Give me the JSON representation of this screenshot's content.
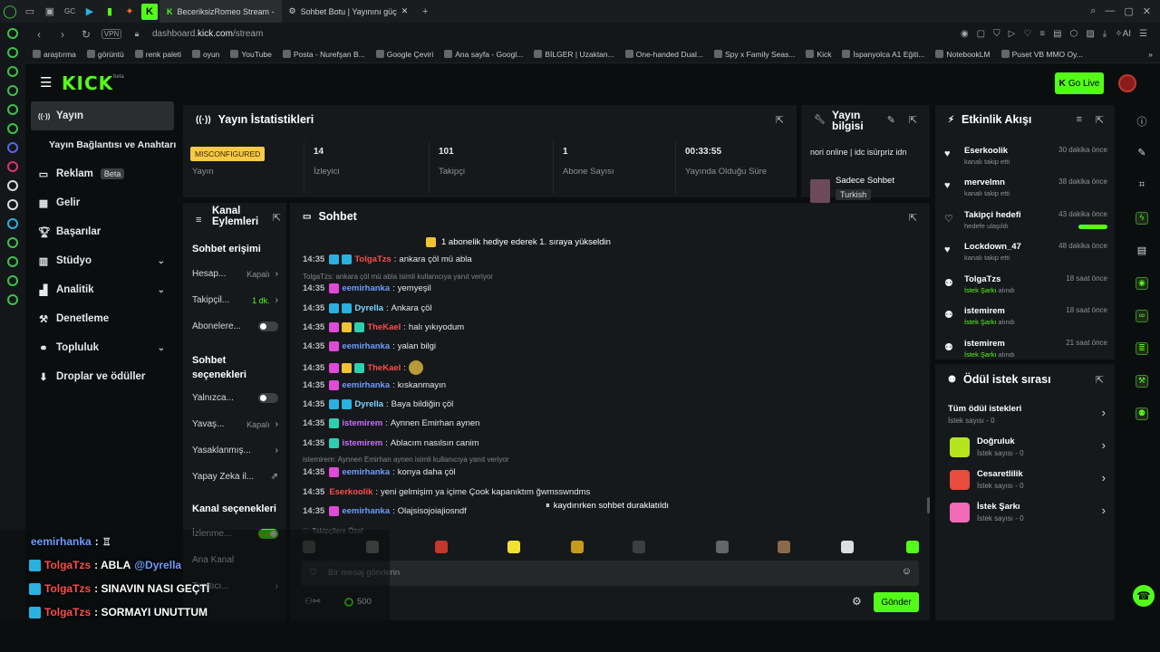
{
  "browser": {
    "tabs": [
      {
        "label": "BeceriksizRomeo Stream -"
      },
      {
        "label": "Sohbet Botu | Yayınını güç"
      }
    ],
    "url_prefix": "dashboard.",
    "url_host": "kick.com",
    "url_path": "/stream",
    "bookmarks": [
      "araştırma",
      "görüntü",
      "renk paleti",
      "oyun",
      "YouTube",
      "Posta - Nurefşan B...",
      "Google Çeviri",
      "Ana sayfa - Googl...",
      "BİLGER | Uzaktan...",
      "One-handed Dual...",
      "Spy x Family Seas...",
      "Kick",
      "İspanyolca A1 Eğiti...",
      "NotebookLM",
      "Puset VB MMO Oy..."
    ]
  },
  "header": {
    "logo": "KICK",
    "go_live": "Go Live"
  },
  "sidebar": {
    "items": [
      {
        "label": "Yayın",
        "icon": "stream-icon"
      },
      {
        "label": "Yayın Bağlantısı ve Anahtarı",
        "icon": ""
      },
      {
        "label": "Reklam",
        "icon": "ad-icon",
        "badge": "Beta"
      },
      {
        "label": "Gelir",
        "icon": "revenue-icon"
      },
      {
        "label": "Başarılar",
        "icon": "trophy-icon"
      },
      {
        "label": "Stüdyo",
        "icon": "studio-icon"
      },
      {
        "label": "Analitik",
        "icon": "analytics-icon"
      },
      {
        "label": "Denetleme",
        "icon": "moderation-icon"
      },
      {
        "label": "Topluluk",
        "icon": "community-icon"
      },
      {
        "label": "Droplar ve ödüller",
        "icon": "drops-icon"
      }
    ]
  },
  "stats": {
    "title": "Yayın İstatistikleri",
    "status_badge": "MISCONFIGURED",
    "status_label": "Yayın",
    "cells": [
      {
        "value": "14",
        "label": "İzleyici"
      },
      {
        "value": "101",
        "label": "Takipçi"
      },
      {
        "value": "1",
        "label": "Abone Sayısı"
      },
      {
        "value": "00:33:55",
        "label": "Yayında Olduğu Süre"
      }
    ]
  },
  "stream_info": {
    "title": "Yayın bilgisi",
    "stream_title": "nori online | idc isürpriz idn",
    "category": "Sadece Sohbet",
    "language": "Turkish"
  },
  "channel_actions": {
    "title_line1": "Kanal",
    "title_line2": "Eylemleri",
    "chat_access": "Sohbet erişimi",
    "rows1": [
      {
        "label": "Hesap...",
        "value": "Kapalı",
        "kind": "arrow"
      },
      {
        "label": "Takipçil...",
        "value": "1 dk.",
        "kind": "arrow"
      },
      {
        "label": "Abonelere...",
        "value": "",
        "kind": "toggle-off"
      }
    ],
    "chat_options_line1": "Sohbet",
    "chat_options_line2": "seçenekleri",
    "rows2": [
      {
        "label": "Yalnızca...",
        "value": "",
        "kind": "toggle-off"
      },
      {
        "label": "Yavaş...",
        "value": "Kapalı",
        "kind": "arrow"
      },
      {
        "label": "Yasaklanmış...",
        "value": "",
        "kind": "arrow"
      },
      {
        "label": "Yapay Zeka il...",
        "value": "",
        "kind": "ext"
      }
    ],
    "channel_options": "Kanal seçenekleri",
    "rows3": [
      {
        "label": "İzlenme...",
        "value": "",
        "kind": "toggle-on"
      },
      {
        "label": "Ana Kanal",
        "value": "",
        "kind": "none"
      },
      {
        "label": "Tanıtıcı...",
        "value": "",
        "kind": "arrow"
      }
    ]
  },
  "chat": {
    "title": "Sohbet",
    "pinned": "1 abonelik hediye ederek 1. sıraya yükseldin",
    "messages": [
      {
        "time": "14:35",
        "user": "TolgaTzs",
        "color": "#ff4c4c",
        "text": "ankara çöl mü abla",
        "badges": [
          "#2bb0e0",
          "#2bb0e0"
        ]
      },
      {
        "reply": "TolgaTzs: ankara çöl mü abla isimli kullanıcıya yanıt veriyor"
      },
      {
        "time": "14:35",
        "user": "eemirhanka",
        "color": "#6d9cff",
        "text": "yemyeşil",
        "badges": [
          "#e04ad8"
        ]
      },
      {
        "time": "14:35",
        "user": "Dyrella",
        "color": "#7fd6ff",
        "text": "Ankara çöl",
        "badges": [
          "#2bb0e0",
          "#2bb0e0"
        ]
      },
      {
        "time": "14:35",
        "user": "TheKael",
        "color": "#ff4c4c",
        "text": "halı yıkıyodum",
        "badges": [
          "#e04ad8",
          "#f1c232",
          "#2bd0b0"
        ]
      },
      {
        "time": "14:35",
        "user": "eemirhanka",
        "color": "#6d9cff",
        "text": "yalan bilgi",
        "badges": [
          "#e04ad8"
        ]
      },
      {
        "time": "14:35",
        "user": "TheKael",
        "color": "#ff4c4c",
        "text": "",
        "badges": [
          "#e04ad8",
          "#f1c232",
          "#2bd0b0"
        ],
        "emote": true
      },
      {
        "time": "14:35",
        "user": "eemirhanka",
        "color": "#6d9cff",
        "text": "kıskanmayın",
        "badges": [
          "#e04ad8"
        ]
      },
      {
        "time": "14:35",
        "user": "Dyrella",
        "color": "#7fd6ff",
        "text": "Baya bildiğin çöl",
        "badges": [
          "#2bb0e0",
          "#2bb0e0"
        ]
      },
      {
        "time": "14:35",
        "user": "istemirem",
        "color": "#c86dff",
        "text": "Aynnen Emirhan aynen",
        "badges": [
          "#2bd0b0"
        ]
      },
      {
        "time": "14:35",
        "user": "istemirem",
        "color": "#c86dff",
        "text": "Ablacım nasılsın canim",
        "badges": [
          "#2bd0b0"
        ]
      },
      {
        "reply": "istemirem: Aynnen Emirhan aynen isimli kullanıcıya yanıt veriyor"
      },
      {
        "time": "14:35",
        "user": "eemirhanka",
        "color": "#6d9cff",
        "text": "konya daha çöl",
        "badges": [
          "#e04ad8"
        ]
      },
      {
        "time": "14:35",
        "user": "Eserkoolik",
        "color": "#ff4c4c",
        "text": "yeni gelmişim ya içime Çook kapanıktım ğwmsswndms",
        "badges": []
      },
      {
        "time": "14:35",
        "user": "eemirhanka",
        "color": "#6d9cff",
        "text": "Olajsisojoiajiosndf",
        "badges": [
          "#e04ad8"
        ]
      }
    ],
    "paused": "kaydırırken sohbet duraklatıldı",
    "followers_only": "Takipçilere Özel",
    "input_placeholder": "Bir mesaj gönderin",
    "points": "500",
    "send": "Gönder"
  },
  "events": {
    "title": "Etkinlik Akışı",
    "items": [
      {
        "name": "Eserkoolik",
        "sub": "kanalı takip etti",
        "time": "30 dakika önce",
        "icon": "heart-icon"
      },
      {
        "name": "mervelmn",
        "sub": "kanalı takip etti",
        "time": "38 dakika önce",
        "icon": "heart-icon"
      },
      {
        "name": "Takipçi hedefi",
        "sub": "hedefe ulaşıldı",
        "time": "43 dakika önce",
        "icon": "heart-outline-icon",
        "progress": 1.0
      },
      {
        "name": "Lockdown_47",
        "sub": "kanalı takip etti",
        "time": "48 dakika önce",
        "icon": "heart-icon"
      },
      {
        "name": "TolgaTzs",
        "sub_green": "İstek Şarkı",
        "sub": " alındı",
        "time": "18 saat önce",
        "icon": "reward-icon"
      },
      {
        "name": "istemirem",
        "sub_green": "İstek Şarkı",
        "sub": " alındı",
        "time": "18 saat önce",
        "icon": "reward-icon"
      },
      {
        "name": "istemirem",
        "sub_green": "İstek Şarkı",
        "sub": " alındı",
        "time": "21 saat önce",
        "icon": "reward-icon"
      }
    ]
  },
  "rewards": {
    "title": "Ödül istek sırası",
    "all": {
      "name": "Tüm ödül istekleri",
      "sub": "İstek sayısı - 0"
    },
    "items": [
      {
        "name": "Doğruluk",
        "sub": "İstek sayısı - 0",
        "color": "#b5e61d"
      },
      {
        "name": "Cesaretlilik",
        "sub": "İstek sayısı - 0",
        "color": "#e74c3c"
      },
      {
        "name": "İstek Şarkı",
        "sub": "İstek sayısı - 0",
        "color": "#f06ab7"
      }
    ]
  },
  "overlay": {
    "lines": [
      {
        "user": "eemirhanka",
        "text": ":",
        "kind": "m"
      },
      {
        "user": "TolgaTzs",
        "text": ": ABLA ",
        "mention": "@Dyrella",
        "kind": "n"
      },
      {
        "user": "TolgaTzs",
        "text": ": SINAVIN NASI GEÇTİ",
        "kind": "n"
      },
      {
        "user": "TolgaTzs",
        "text": ": SORMAYI UNUTTUM",
        "kind": "n"
      }
    ]
  }
}
